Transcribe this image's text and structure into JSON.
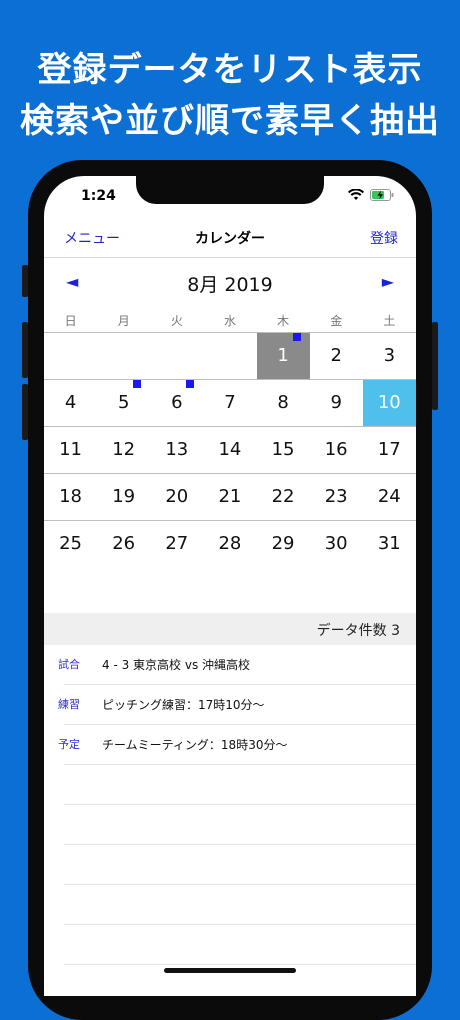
{
  "promo": {
    "line1": "登録データをリスト表示",
    "line2": "検索や並び順で素早く抽出"
  },
  "status": {
    "time": "1:24"
  },
  "nav": {
    "left": "メニュー",
    "title": "カレンダー",
    "right": "登録"
  },
  "calendar": {
    "prev_arrow": "◄",
    "next_arrow": "►",
    "month_label": "8月 2019",
    "weekdays": [
      "日",
      "月",
      "火",
      "水",
      "木",
      "金",
      "土"
    ],
    "weeks": [
      [
        "",
        "",
        "",
        "",
        "1",
        "2",
        "3"
      ],
      [
        "4",
        "5",
        "6",
        "7",
        "8",
        "9",
        "10"
      ],
      [
        "11",
        "12",
        "13",
        "14",
        "15",
        "16",
        "17"
      ],
      [
        "18",
        "19",
        "20",
        "21",
        "22",
        "23",
        "24"
      ],
      [
        "25",
        "26",
        "27",
        "28",
        "29",
        "30",
        "31"
      ]
    ],
    "selected_day": "1",
    "today_day": "10",
    "marked_days": [
      "1",
      "5",
      "6"
    ],
    "colors": {
      "selected": "#8a8a8a",
      "today": "#4fc0ec",
      "marker": "#1a1af0"
    }
  },
  "summary": {
    "count_label": "データ件数 3"
  },
  "entries": [
    {
      "kind": "試合",
      "desc": "4 - 3  東京高校 vs 沖縄高校"
    },
    {
      "kind": "練習",
      "desc": "ピッチング練習：17時10分〜"
    },
    {
      "kind": "予定",
      "desc": "チームミーティング：18時30分〜"
    }
  ],
  "colors": {
    "background": "#0c6fd3",
    "accent": "#2222cc"
  }
}
